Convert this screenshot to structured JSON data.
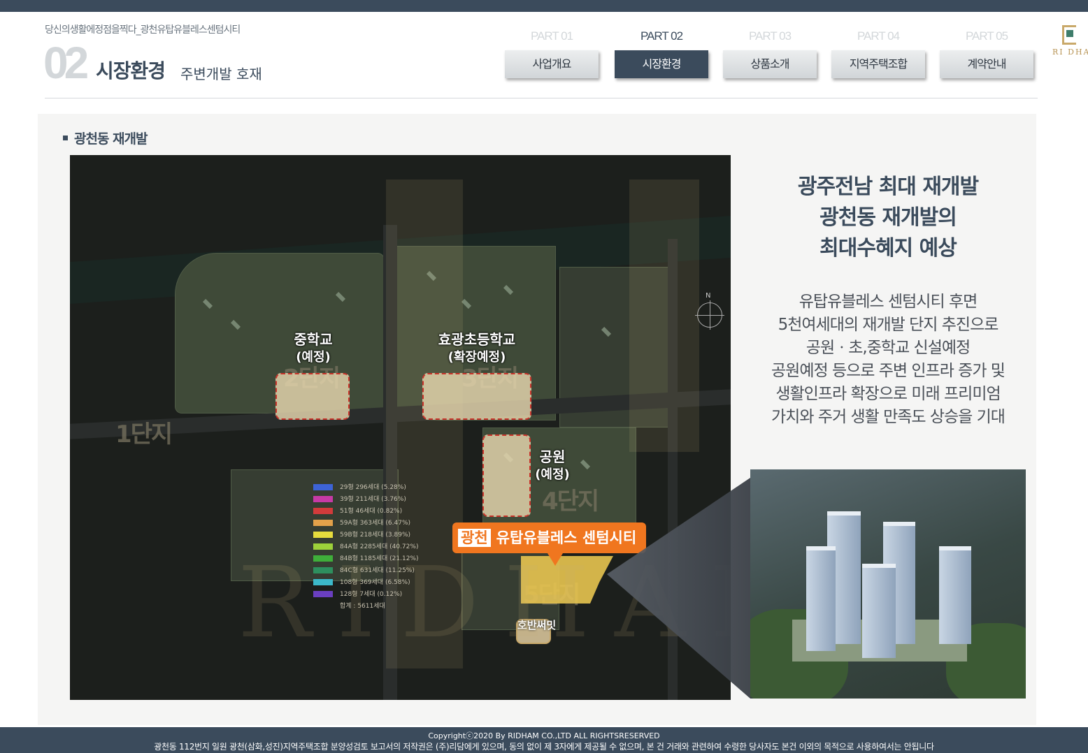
{
  "header": {
    "subtitle": "당신의생활에정점을찍다_광천유탑유블레스센텀시티",
    "section_number": "02",
    "section_title": "시장환경",
    "section_subtitle": "주변개발 호재"
  },
  "tabs": [
    {
      "part": "PART 01",
      "label": "사업개요",
      "active": false
    },
    {
      "part": "PART 02",
      "label": "시장환경",
      "active": true
    },
    {
      "part": "PART 03",
      "label": "상품소개",
      "active": false
    },
    {
      "part": "PART 04",
      "label": "지역주택조합",
      "active": false
    },
    {
      "part": "PART 05",
      "label": "계약안내",
      "active": false
    }
  ],
  "logo": {
    "text": "RI DHAM",
    "icon": "ridham-logo-icon"
  },
  "content": {
    "bullet_title": "광천동 재개발",
    "map": {
      "zones": {
        "middle_school": {
          "line1": "중학교",
          "line2": "(예정)"
        },
        "elementary": {
          "line1": "효광초등학교",
          "line2": "(확장예정)"
        },
        "park": {
          "line1": "공원",
          "line2": "(예정)"
        }
      },
      "danji": [
        "1단지",
        "2단지",
        "3단지",
        "4단지",
        "5단지"
      ],
      "callout": {
        "tag": "광천",
        "name": "유탑유블레스 센텀시티"
      },
      "hoban": "호반써밋",
      "watermark": "RIDHAM",
      "legend": [
        {
          "type": "29형",
          "count": "296세대",
          "pct": "(5.28%)",
          "color": "#3d63d6"
        },
        {
          "type": "39형",
          "count": "211세대",
          "pct": "(3.76%)",
          "color": "#c63aa6"
        },
        {
          "type": "51형",
          "count": "46세대",
          "pct": "(0.82%)",
          "color": "#d23b3b"
        },
        {
          "type": "59A형",
          "count": "363세대",
          "pct": "(6.47%)",
          "color": "#e3a14a"
        },
        {
          "type": "59B형",
          "count": "218세대",
          "pct": "(3.89%)",
          "color": "#e6dc3d"
        },
        {
          "type": "84A형",
          "count": "2285세대",
          "pct": "(40.72%)",
          "color": "#9dd13a"
        },
        {
          "type": "84B형",
          "count": "1185세대",
          "pct": "(21.12%)",
          "color": "#3fae3a"
        },
        {
          "type": "84C형",
          "count": "631세대",
          "pct": "(11.25%)",
          "color": "#2e8f5e"
        },
        {
          "type": "108형",
          "count": "369세대",
          "pct": "(6.58%)",
          "color": "#3cb9c9"
        },
        {
          "type": "128형",
          "count": "7세대",
          "pct": "(0.12%)",
          "color": "#6a3fc0"
        }
      ],
      "legend_total": "합계 : 5611세대",
      "north": "N"
    },
    "headline": [
      "광주전남 최대 재개발",
      "광천동 재개발의",
      "최대수혜지 예상"
    ],
    "description": [
      "유탑유블레스 센텀시티 후면",
      "5천여세대의 재개발 단지 추진으로",
      "공원ㆍ초,중학교 신설예정",
      "공원예정 등으로 주변 인프라 증가 및",
      "생활인프라  확장으로 미래 프리미엄",
      "가치와 주거 생활 만족도 상승을 기대"
    ]
  },
  "footer": {
    "copyright": "Copyrightⓒ2020 By RIDHAM CO.,LTD ALL RIGHTSRESERVED",
    "notice": "광천동 112번지 일원 광천(삼화,성진)지역주택조합 분양성검토 보고서의 저작권은 (주)리담에게 있으며, 동의 없이 제 3자에게 제공될 수 없으며, 본 건 거래와 관련하여 수령한 당사자도 본건 이외의 목적으로 사용하여서는 안됩니다"
  }
}
